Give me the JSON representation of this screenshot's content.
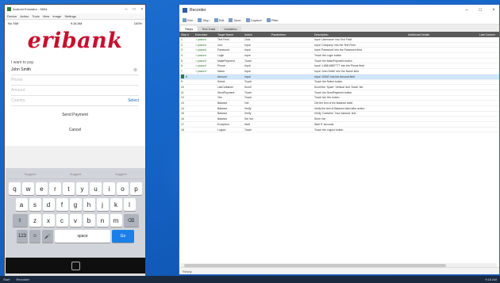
{
  "phone": {
    "window_title": "Android Emulator - 5554",
    "menu": [
      "Device",
      "Action",
      "Tools",
      "View",
      "Image",
      "Settings"
    ],
    "status_left": "No SIM",
    "status_center": "9:18 AM",
    "status_right": "100%",
    "logo": "eribank",
    "welcome": "I want to pay",
    "fields": {
      "name_value": "John Smith",
      "phone_placeholder": "Phone",
      "amount_placeholder": "Amount",
      "country_placeholder": "Country",
      "select_label": "Select"
    },
    "send_payment": "Send Payment",
    "cancel": "Cancel",
    "suggestions": [
      "Suggest",
      "Suggest",
      "Suggest"
    ],
    "keys": {
      "row1": [
        "q",
        "w",
        "e",
        "r",
        "t",
        "y",
        "u",
        "i",
        "o",
        "p"
      ],
      "row2": [
        "a",
        "s",
        "d",
        "f",
        "g",
        "h",
        "j",
        "k",
        "l"
      ],
      "row3": [
        "z",
        "x",
        "c",
        "v",
        "b",
        "n",
        "m"
      ],
      "shift": "⇧",
      "backspace": "⌫",
      "numbers": "123",
      "globe": "☺",
      "mic": "🎤",
      "space": "space",
      "go": "Go"
    }
  },
  "runner": {
    "window_title": "Recorder",
    "toolbar": [
      "Run",
      "Stop",
      "Edit",
      "Save",
      "Capture",
      "Filter"
    ],
    "tabs": [
      "Steps",
      "Test Data",
      "Variables"
    ],
    "headers": [
      "Step #",
      "Execution",
      "Target Name",
      "Action",
      "Parameters",
      "Description",
      "Additional Details",
      "Last Column"
    ],
    "rows": [
      {
        "num": "1",
        "status": "passed",
        "target": "Text Field",
        "action": "Click",
        "param": "",
        "desc": "Input 'Username' into Text Field"
      },
      {
        "num": "2",
        "status": "passed",
        "target": "Icon",
        "action": "Input",
        "param": "",
        "desc": "Input 'Company' into the Text Field"
      },
      {
        "num": "3",
        "status": "passed",
        "target": "Password",
        "action": "Input",
        "param": "",
        "desc": "Input 'Password' into the Password field"
      },
      {
        "num": "4",
        "status": "passed",
        "target": "Login",
        "action": "Input",
        "param": "",
        "desc": "Touch the Login button"
      },
      {
        "num": "5",
        "status": "passed",
        "target": "MakePayment",
        "action": "Touch",
        "param": "",
        "desc": "Touch the MakePayment button"
      },
      {
        "num": "6",
        "status": "passed",
        "target": "Phone",
        "action": "Input",
        "param": "",
        "desc": "Input '1-888-8887777' into the Phone field"
      },
      {
        "num": "7",
        "status": "passed",
        "target": "Name",
        "action": "Input",
        "param": "",
        "desc": "Input 'John Smith' into the Name field"
      },
      {
        "num": "8",
        "status": "",
        "target": "Amount",
        "action": "Input",
        "param": "",
        "desc": "Input '10000' into the Amount field"
      },
      {
        "num": "9",
        "status": "",
        "target": "Select",
        "action": "Touch",
        "param": "",
        "desc": "Touch the Select button"
      },
      {
        "num": "10",
        "status": "",
        "target": "ListContainer",
        "action": "Scroll",
        "param": "",
        "desc": "Scroll the 'Spain' 'Vertical' and 'Down' list"
      },
      {
        "num": "11",
        "status": "",
        "target": "SendPayment",
        "action": "Touch",
        "param": "",
        "desc": "Touch the SendPayment button"
      },
      {
        "num": "12",
        "status": "",
        "target": "Yes",
        "action": "Touch",
        "param": "",
        "desc": "Touch the Yes button"
      },
      {
        "num": "13",
        "status": "",
        "target": "Balance",
        "action": "Get",
        "param": "",
        "desc": "Get the text of the Balance label"
      },
      {
        "num": "14",
        "status": "",
        "target": "Balance",
        "action": "Verify",
        "param": "",
        "desc": "Verify the text of Balance label after action"
      },
      {
        "num": "15",
        "status": "",
        "target": "Balance",
        "action": "Verify",
        "param": "",
        "desc": "Verify 'Contains' 'Your balance' text"
      },
      {
        "num": "16",
        "status": "",
        "target": "Balance",
        "action": "Set Var",
        "param": "",
        "desc": "Store Var"
      },
      {
        "num": "17",
        "status": "",
        "target": "Exception",
        "action": "Wait",
        "param": "",
        "desc": "Wait '5' seconds"
      },
      {
        "num": "18",
        "status": "",
        "target": "Logout",
        "action": "Touch",
        "param": "",
        "desc": "Touch the Logout button"
      }
    ],
    "selected_row_index": 7,
    "status_text": "Ready"
  },
  "taskbar": {
    "left_item": "Start",
    "task_label": "Recorder",
    "tray_time": "9:18 AM"
  }
}
